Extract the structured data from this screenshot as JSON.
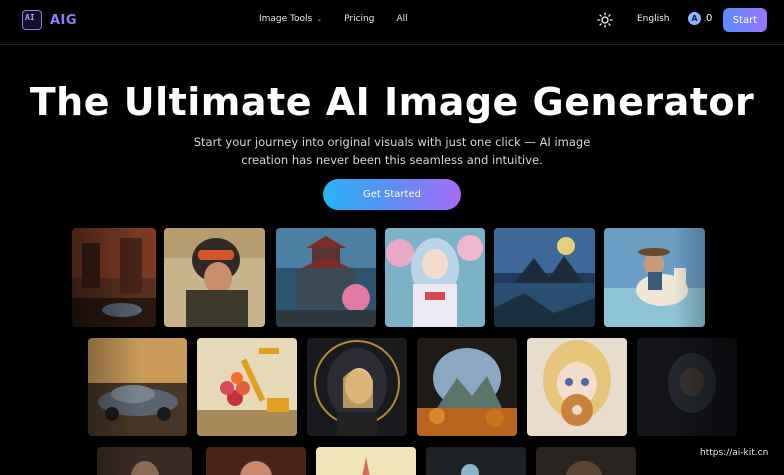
{
  "header": {
    "logo_mark": "AI",
    "brand": "AIG",
    "nav": [
      {
        "label": "Image Tools"
      },
      {
        "label": "Pricing"
      },
      {
        "label": "All"
      }
    ],
    "theme_icon": "sun-icon",
    "language": "English",
    "credit_icon": "A",
    "credits": "0",
    "start_label": "Start"
  },
  "hero": {
    "title": "The Ultimate AI Image Generator",
    "subtitle": "Start your journey into original visuals with just one click — AI image creation has never been this seamless and intuitive.",
    "cta_label": "Get Started"
  },
  "gallery": {
    "images": [
      "street-scene-tile",
      "soldier-with-goggles-tile",
      "pagoda-town-tile",
      "anime-girl-in-blossoms-tile",
      "castle-by-lake-tile",
      "cowgirl-on-horse-tile",
      "vintage-car-tile",
      "fruit-excavator-tile",
      "hooded-girl-tile",
      "cave-landscape-tile",
      "girl-eating-donut-tile",
      "dark-portrait-tile"
    ]
  },
  "watermark": "https://ai-kit.cn",
  "colors": {
    "accent": "#8d7cff",
    "cta_start": "#28b4f4",
    "cta_end": "#a76af5"
  }
}
